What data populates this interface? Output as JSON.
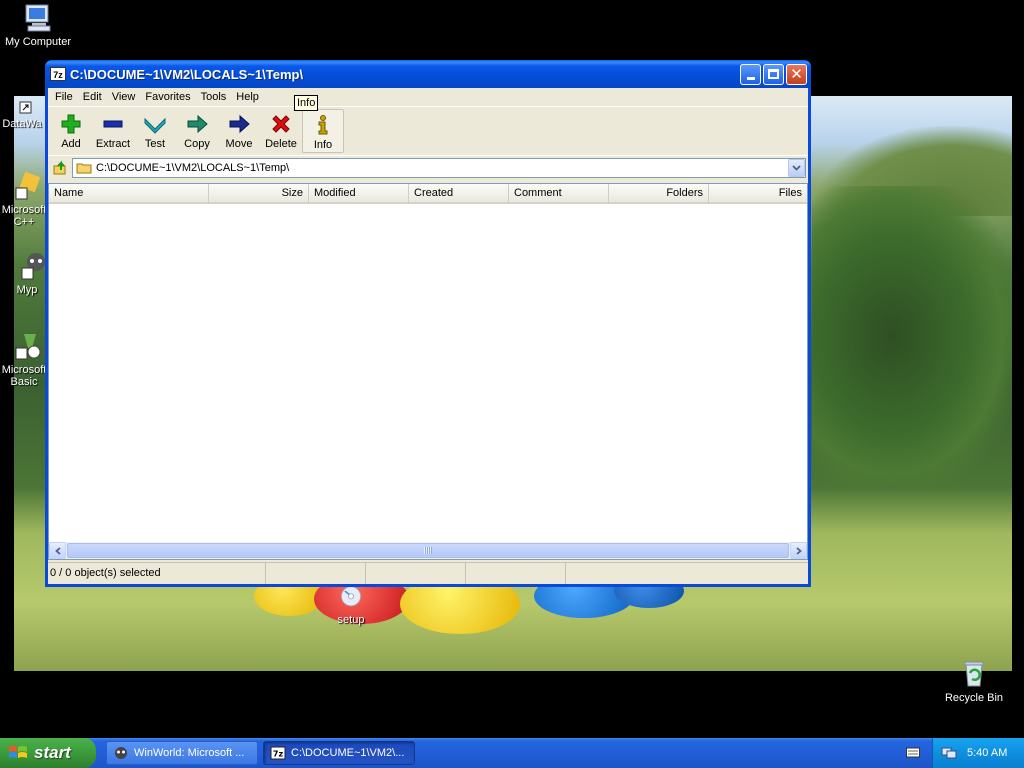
{
  "desktop": {
    "icons": [
      {
        "label": "My Computer"
      },
      {
        "label": "DataWa"
      },
      {
        "label": "Microsoft C++"
      },
      {
        "label": "Myp"
      },
      {
        "label": "Microsoft Basic"
      },
      {
        "label": "setup"
      },
      {
        "label": "Recycle Bin"
      }
    ]
  },
  "window": {
    "app_icon_text": "7z",
    "title": "C:\\DOCUME~1\\VM2\\LOCALS~1\\Temp\\",
    "menu": [
      "File",
      "Edit",
      "View",
      "Favorites",
      "Tools",
      "Help"
    ],
    "toolbar": [
      {
        "label": "Add",
        "icon": "plus-icon",
        "color": "#1fae1f"
      },
      {
        "label": "Extract",
        "icon": "minus-icon",
        "color": "#1a2fb0"
      },
      {
        "label": "Test",
        "icon": "checkmark-icon",
        "color": "#22a8b8"
      },
      {
        "label": "Copy",
        "icon": "arrow-right-icon",
        "color": "#1f8a6a"
      },
      {
        "label": "Move",
        "icon": "arrow-right-icon",
        "color": "#1a2a90"
      },
      {
        "label": "Delete",
        "icon": "x-icon",
        "color": "#d81010"
      },
      {
        "label": "Info",
        "icon": "info-icon",
        "color": "#c9a400"
      }
    ],
    "tooltip": "Info",
    "address": "C:\\DOCUME~1\\VM2\\LOCALS~1\\Temp\\",
    "columns": [
      "Name",
      "Size",
      "Modified",
      "Created",
      "Comment",
      "Folders",
      "Files"
    ],
    "rows": [],
    "status": [
      "0 / 0 object(s) selected",
      "",
      "",
      "",
      ""
    ]
  },
  "taskbar": {
    "start_label": "start",
    "tasks": [
      {
        "label": "WinWorld: Microsoft ...",
        "active": false
      },
      {
        "label": "C:\\DOCUME~1\\VM2\\...",
        "active": true
      }
    ],
    "clock": "5:40 AM"
  }
}
